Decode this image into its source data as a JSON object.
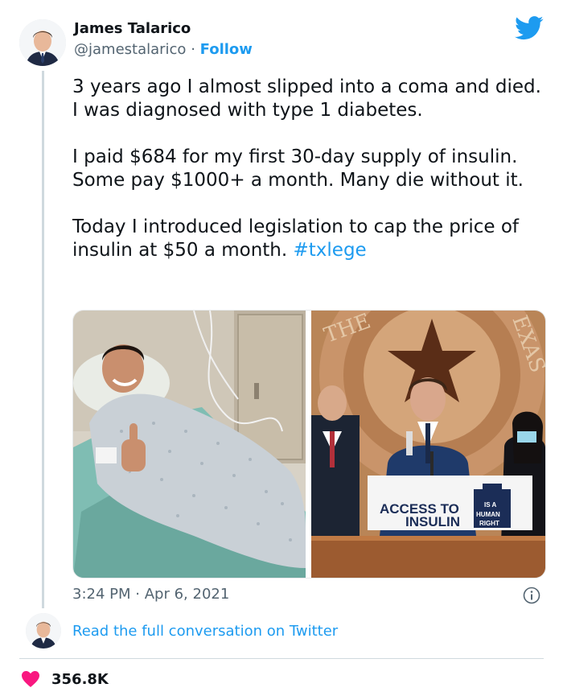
{
  "author": {
    "name": "James Talarico",
    "handle": "@jamestalarico",
    "separator": "·",
    "follow_label": "Follow"
  },
  "tweet": {
    "paragraph1": "3 years ago I almost slipped into a coma and died. I was diagnosed with type 1 diabetes.",
    "paragraph2": "I paid $684 for my first 30-day supply of insulin. Some pay $1000+ a month. Many die without it.",
    "paragraph3": "Today I introduced legislation to cap the price of insulin at $50 a month. ",
    "hashtag": "#txlege"
  },
  "media": {
    "photo_right": {
      "sign_line1": "ACCESS TO",
      "sign_line2": "INSULIN",
      "badge_line1": "IS A",
      "badge_line2": "HUMAN",
      "badge_line3": "RIGHT",
      "wall_text_left": "THE",
      "wall_text_right": "EXAS"
    }
  },
  "meta": {
    "time": "3:24 PM",
    "separator": "·",
    "date": "Apr 6, 2021"
  },
  "conversation_link": "Read the full conversation on Twitter",
  "likes_count": "356.8K",
  "colors": {
    "accent": "#1d9bf0",
    "like": "#f91880",
    "text": "#0f1419",
    "secondary": "#536471"
  },
  "icons": {
    "brand": "twitter-bird-icon",
    "info": "info-icon",
    "like": "heart-icon"
  }
}
